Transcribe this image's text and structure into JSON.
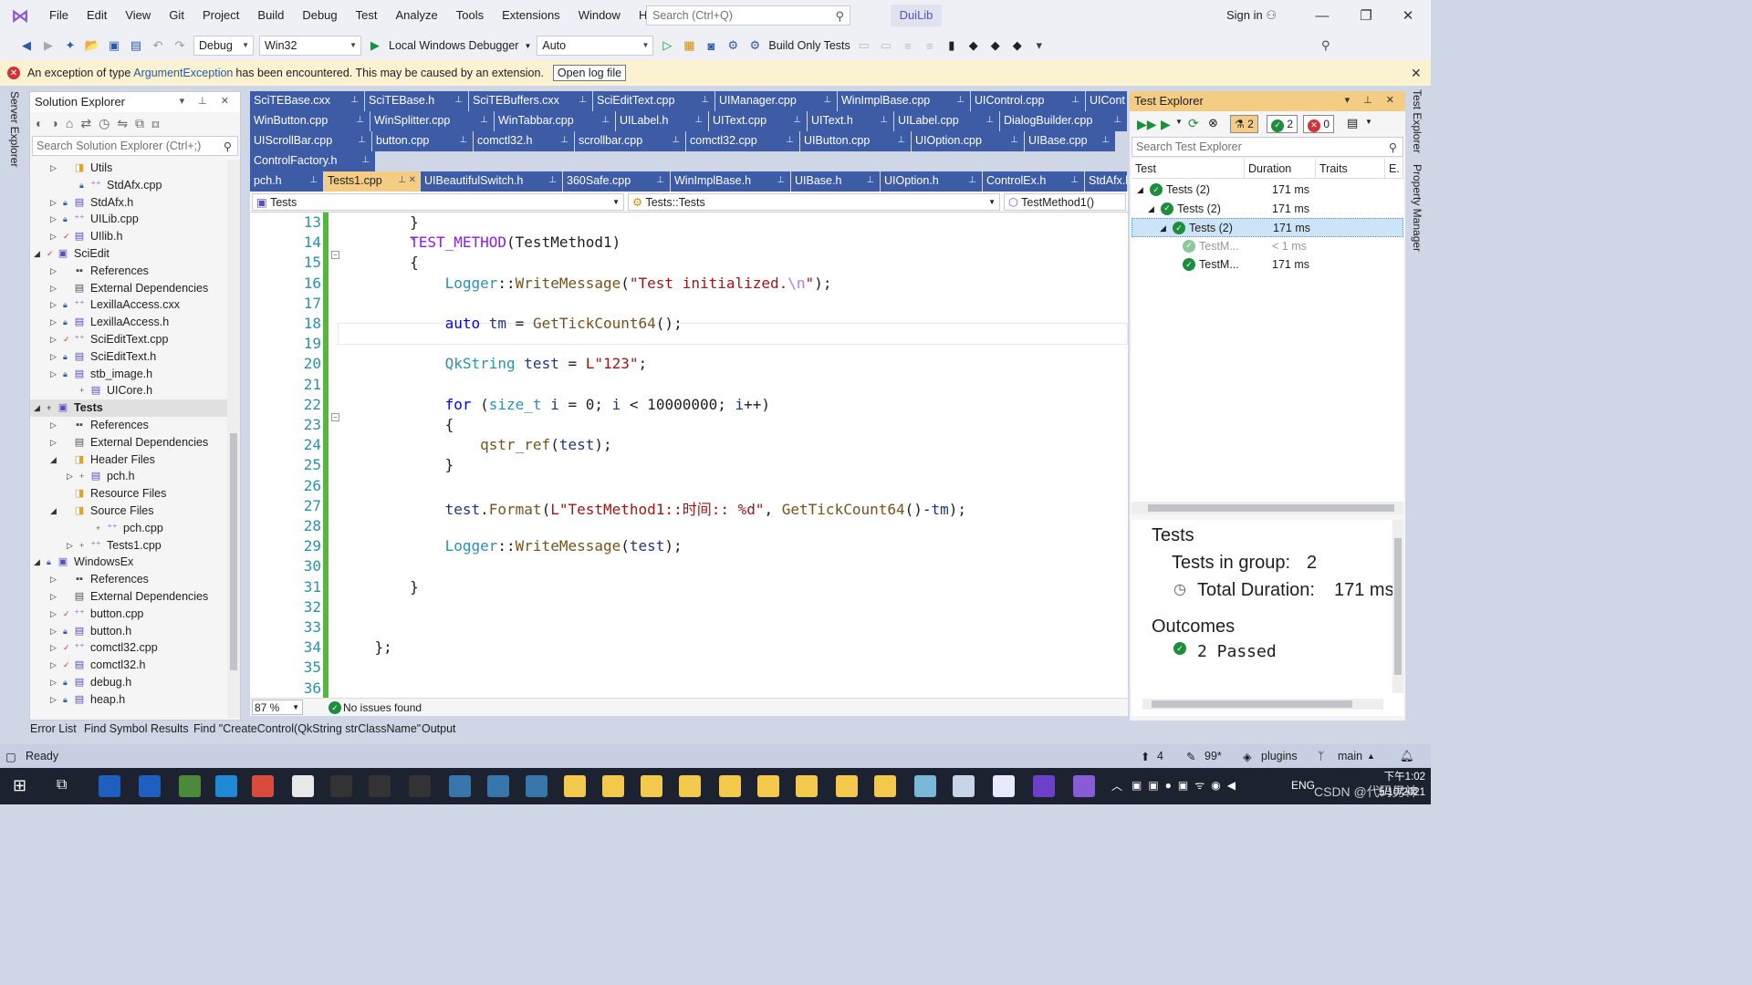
{
  "menu": [
    "File",
    "Edit",
    "View",
    "Git",
    "Project",
    "Build",
    "Debug",
    "Test",
    "Analyze",
    "Tools",
    "Extensions",
    "Window",
    "Help"
  ],
  "search": {
    "placeholder": "Search (Ctrl+Q)"
  },
  "solution_name": "DuiLib",
  "signin": "Sign in",
  "toolbar": {
    "config": "Debug",
    "platform": "Win32",
    "debugger": "Local Windows Debugger",
    "auto": "Auto",
    "build_only": "Build Only Tests"
  },
  "infobar": {
    "prefix": "An exception of type ",
    "link": "ArgumentException",
    "suffix": " has been encountered. This may be caused by an extension.",
    "button": "Open log file"
  },
  "side_tabs": {
    "left": "Server Explorer",
    "right1": "Test Explorer",
    "right2": "Property Manager"
  },
  "solution_explorer": {
    "title": "Solution Explorer",
    "search_placeholder": "Search Solution Explorer (Ctrl+;)",
    "items": [
      {
        "label": "Utils",
        "level": 2,
        "exp": "▷",
        "mk": "",
        "icon": "folder"
      },
      {
        "label": "StdAfx.cpp",
        "level": 3,
        "exp": "",
        "mk": "lock",
        "icon": "cpp"
      },
      {
        "label": "StdAfx.h",
        "level": 2,
        "exp": "▷",
        "mk": "lock",
        "icon": "h"
      },
      {
        "label": "UILib.cpp",
        "level": 2,
        "exp": "▷",
        "mk": "lock",
        "icon": "cpp"
      },
      {
        "label": "UIlib.h",
        "level": 2,
        "exp": "▷",
        "mk": "check",
        "icon": "h"
      },
      {
        "label": "SciEdit",
        "level": 1,
        "exp": "◢",
        "mk": "check",
        "icon": "proj"
      },
      {
        "label": "References",
        "level": 2,
        "exp": "▷",
        "mk": "",
        "icon": "ref"
      },
      {
        "label": "External Dependencies",
        "level": 2,
        "exp": "▷",
        "mk": "",
        "icon": "ext"
      },
      {
        "label": "LexillaAccess.cxx",
        "level": 2,
        "exp": "▷",
        "mk": "lock",
        "icon": "cpp"
      },
      {
        "label": "LexillaAccess.h",
        "level": 2,
        "exp": "▷",
        "mk": "lock",
        "icon": "h"
      },
      {
        "label": "SciEditText.cpp",
        "level": 2,
        "exp": "▷",
        "mk": "check",
        "icon": "cpp"
      },
      {
        "label": "SciEditText.h",
        "level": 2,
        "exp": "▷",
        "mk": "lock",
        "icon": "h"
      },
      {
        "label": "stb_image.h",
        "level": 2,
        "exp": "▷",
        "mk": "lock",
        "icon": "h"
      },
      {
        "label": "UICore.h",
        "level": 3,
        "exp": "",
        "mk": "plus",
        "icon": "h"
      },
      {
        "label": "Tests",
        "level": 1,
        "exp": "◢",
        "mk": "plus",
        "icon": "proj",
        "selected": true
      },
      {
        "label": "References",
        "level": 2,
        "exp": "▷",
        "mk": "",
        "icon": "ref"
      },
      {
        "label": "External Dependencies",
        "level": 2,
        "exp": "▷",
        "mk": "",
        "icon": "ext"
      },
      {
        "label": "Header Files",
        "level": 2,
        "exp": "◢",
        "mk": "",
        "icon": "folder"
      },
      {
        "label": "pch.h",
        "level": 3,
        "exp": "▷",
        "mk": "plus",
        "icon": "h"
      },
      {
        "label": "Resource Files",
        "level": 2,
        "exp": "",
        "mk": "",
        "icon": "folder"
      },
      {
        "label": "Source Files",
        "level": 2,
        "exp": "◢",
        "mk": "",
        "icon": "folder"
      },
      {
        "label": "pch.cpp",
        "level": 4,
        "exp": "",
        "mk": "plus",
        "icon": "cpp"
      },
      {
        "label": "Tests1.cpp",
        "level": 3,
        "exp": "▷",
        "mk": "plus",
        "icon": "cpp"
      },
      {
        "label": "WindowsEx",
        "level": 1,
        "exp": "◢",
        "mk": "lock",
        "icon": "proj"
      },
      {
        "label": "References",
        "level": 2,
        "exp": "▷",
        "mk": "",
        "icon": "ref"
      },
      {
        "label": "External Dependencies",
        "level": 2,
        "exp": "▷",
        "mk": "",
        "icon": "ext"
      },
      {
        "label": "button.cpp",
        "level": 2,
        "exp": "▷",
        "mk": "check",
        "icon": "cpp"
      },
      {
        "label": "button.h",
        "level": 2,
        "exp": "▷",
        "mk": "lock",
        "icon": "h"
      },
      {
        "label": "comctl32.cpp",
        "level": 2,
        "exp": "▷",
        "mk": "check",
        "icon": "cpp"
      },
      {
        "label": "comctl32.h",
        "level": 2,
        "exp": "▷",
        "mk": "check",
        "icon": "h"
      },
      {
        "label": "debug.h",
        "level": 2,
        "exp": "▷",
        "mk": "lock",
        "icon": "h"
      },
      {
        "label": "heap.h",
        "level": 2,
        "exp": "▷",
        "mk": "lock",
        "icon": "h"
      }
    ]
  },
  "tab_rows": [
    [
      {
        "label": "SciTEBase.cxx",
        "w": 126
      },
      {
        "label": "SciTEBase.h",
        "w": 114
      },
      {
        "label": "SciTEBuffers.cxx",
        "w": 136
      },
      {
        "label": "SciEditText.cpp",
        "w": 134
      },
      {
        "label": "UIManager.cpp",
        "w": 134
      },
      {
        "label": "WinImplBase.cpp",
        "w": 146
      },
      {
        "label": "UIControl.cpp",
        "w": 126
      },
      {
        "label": "UICont",
        "w": 46
      }
    ],
    [
      {
        "label": "WinButton.cpp",
        "w": 132
      },
      {
        "label": "WinSplitter.cpp",
        "w": 136
      },
      {
        "label": "WinTabbar.cpp",
        "w": 133
      },
      {
        "label": "UILabel.h",
        "w": 102
      },
      {
        "label": "UIText.cpp",
        "w": 108
      },
      {
        "label": "UIText.h",
        "w": 95
      },
      {
        "label": "UILabel.cpp",
        "w": 116
      },
      {
        "label": "DialogBuilder.cpp",
        "w": 140
      }
    ],
    [
      {
        "label": "UIScrollBar.cpp",
        "w": 134
      },
      {
        "label": "button.cpp",
        "w": 111
      },
      {
        "label": "comctl32.h",
        "w": 111
      },
      {
        "label": "scrollbar.cpp",
        "w": 122
      },
      {
        "label": "comctl32.cpp",
        "w": 125
      },
      {
        "label": "UIButton.cpp",
        "w": 122
      },
      {
        "label": "UIOption.cpp",
        "w": 124
      },
      {
        "label": "UIBase.cpp",
        "w": 100
      }
    ],
    [
      {
        "label": "ControlFactory.h",
        "w": 138
      }
    ],
    [
      {
        "label": "pch.h",
        "w": 81
      },
      {
        "label": "Tests1.cpp",
        "w": 106,
        "active": true
      },
      {
        "label": "UIBeautifulSwitch.h",
        "w": 156
      },
      {
        "label": "360Safe.cpp",
        "w": 118
      },
      {
        "label": "WinImplBase.h",
        "w": 132
      },
      {
        "label": "UIBase.h",
        "w": 98
      },
      {
        "label": "UIOption.h",
        "w": 112
      },
      {
        "label": "ControlEx.h",
        "w": 112
      },
      {
        "label": "StdAfx.h",
        "w": 47
      }
    ]
  ],
  "nav": {
    "project": "Tests",
    "scope": "Tests::Tests",
    "member": "TestMethod1()"
  },
  "code_lines": [
    {
      "n": "13",
      "c": "        }"
    },
    {
      "n": "14",
      "c": "        TEST_METHOD(TestMethod1)"
    },
    {
      "n": "15",
      "c": "        {"
    },
    {
      "n": "16",
      "c": "            Logger::WriteMessage(\"Test initialized.\\n\");"
    },
    {
      "n": "17",
      "c": ""
    },
    {
      "n": "18",
      "c": "            auto tm = GetTickCount64();"
    },
    {
      "n": "19",
      "c": ""
    },
    {
      "n": "20",
      "c": "            QkString test = L\"123\";"
    },
    {
      "n": "21",
      "c": ""
    },
    {
      "n": "22",
      "c": "            for (size_t i = 0; i < 10000000; i++)"
    },
    {
      "n": "23",
      "c": "            {"
    },
    {
      "n": "24",
      "c": "                qstr_ref(test);"
    },
    {
      "n": "25",
      "c": "            }"
    },
    {
      "n": "26",
      "c": ""
    },
    {
      "n": "27",
      "c": "            test.Format(L\"TestMethod1::时间:: %d\", GetTickCount64()-tm);"
    },
    {
      "n": "28",
      "c": ""
    },
    {
      "n": "29",
      "c": "            Logger::WriteMessage(test);"
    },
    {
      "n": "30",
      "c": ""
    },
    {
      "n": "31",
      "c": "        }"
    },
    {
      "n": "32",
      "c": ""
    },
    {
      "n": "33",
      "c": ""
    },
    {
      "n": "34",
      "c": "    };"
    },
    {
      "n": "35",
      "c": ""
    },
    {
      "n": "36",
      "c": ""
    }
  ],
  "editor_status": {
    "zoom": "87 %",
    "issues": "No issues found"
  },
  "test_explorer": {
    "title": "Test Explorer",
    "counts": {
      "total": "2",
      "passed": "2",
      "failed": "0"
    },
    "search_placeholder": "Search Test Explorer",
    "columns": [
      "Test",
      "Duration",
      "Traits",
      "E."
    ],
    "rows": [
      {
        "label": "Tests (2)",
        "duration": "171 ms",
        "indent": 0
      },
      {
        "label": "Tests (2)",
        "duration": "171 ms",
        "indent": 1
      },
      {
        "label": "Tests (2)",
        "duration": "171 ms",
        "indent": 2,
        "selected": true
      },
      {
        "label": "TestM...",
        "duration": "< 1 ms",
        "indent": 3,
        "dim": true
      },
      {
        "label": "TestM...",
        "duration": "171 ms",
        "indent": 3
      }
    ],
    "detail": {
      "heading": "Tests",
      "group_label": "Tests in group:",
      "group_count": "2",
      "duration_label": "Total Duration:",
      "duration_value": "171 ms",
      "outcomes": "Outcomes",
      "passed": "2 Passed"
    }
  },
  "bottom_tabs": [
    "Error List",
    "Find Symbol Results",
    "Find \"CreateControl(QkString strClassName\"",
    "Output"
  ],
  "status": {
    "ready": "Ready",
    "up": "4",
    "pencil": "99*",
    "repo": "plugins",
    "branch": "main"
  },
  "taskbar": {
    "lang": "ENG",
    "time": "下午1:02",
    "date": "5/10/2021",
    "watermark": "CSDN @代码男神"
  }
}
